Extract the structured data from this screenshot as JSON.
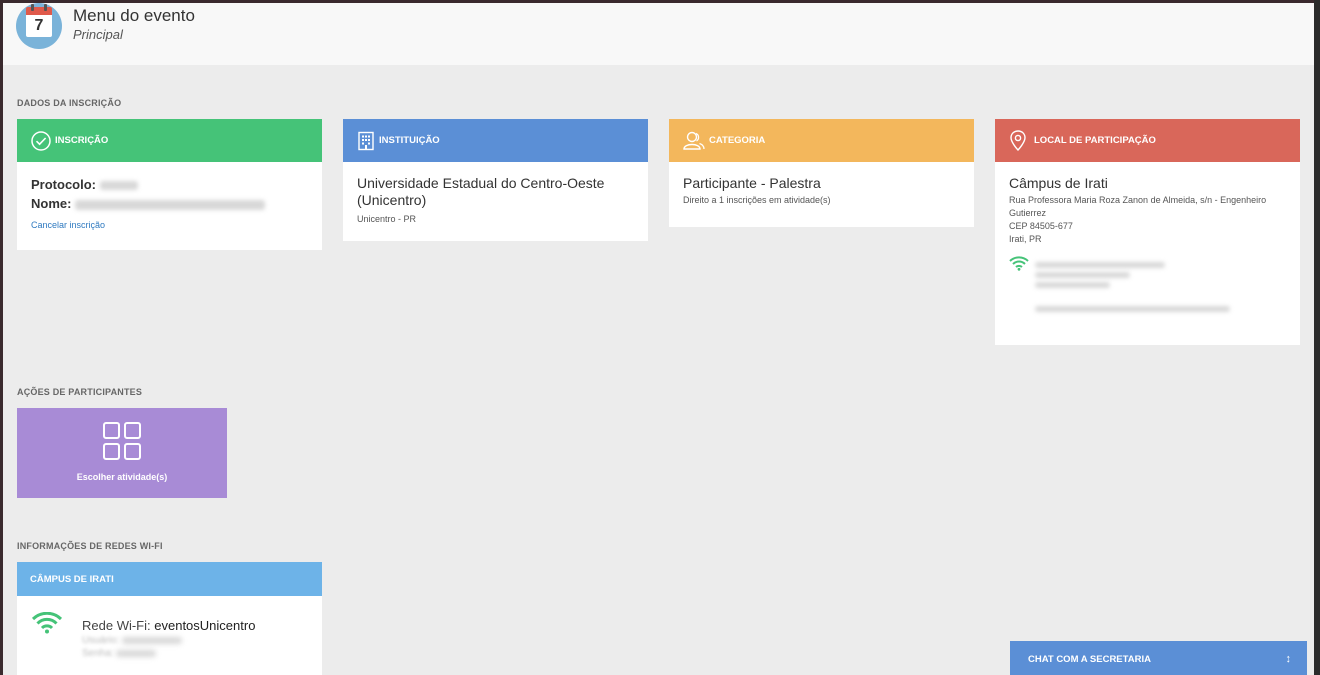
{
  "header": {
    "calendar_day": "7",
    "title": "Menu do evento",
    "subtitle": "Principal"
  },
  "sections": {
    "registration": "DADOS DA INSCRIÇÃO",
    "actions": "AÇÕES DE PARTICIPANTES",
    "wifi": "INFORMAÇÕES DE REDES WI-FI"
  },
  "cards": {
    "inscricao": {
      "title": "INSCRIÇÃO",
      "color": "#45c378",
      "protocolo_label": "Protocolo:",
      "nome_label": "Nome:",
      "cancel_link": "Cancelar inscrição"
    },
    "instituicao": {
      "title": "INSTITUIÇÃO",
      "color": "#5b8fd6",
      "name": "Universidade Estadual do Centro-Oeste (Unicentro)",
      "location": "Unicentro - PR"
    },
    "categoria": {
      "title": "CATEGORIA",
      "color": "#f3b75c",
      "name": "Participante - Palestra",
      "detail": "Direito a 1 inscrições em atividade(s)"
    },
    "local": {
      "title": "LOCAL DE PARTICIPAÇÃO",
      "color": "#d9675a",
      "name": "Câmpus de Irati",
      "address": "Rua Professora Maria Roza Zanon de Almeida, s/n - Engenheiro Gutierrez",
      "cep": "CEP 84505-677",
      "city": "Irati, PR"
    }
  },
  "actions": {
    "choose_activity": "Escolher atividade(s)",
    "color": "#a88bd6"
  },
  "wifi": {
    "campus_title": "CÂMPUS DE IRATI",
    "color": "#6db3e8",
    "network_label": "Rede Wi-Fi:",
    "network_name": "eventosUnicentro",
    "user_label": "Usuário:",
    "password_label": "Senha:"
  },
  "chat": {
    "label": "CHAT COM A SECRETARIA",
    "toggle": "↕"
  }
}
